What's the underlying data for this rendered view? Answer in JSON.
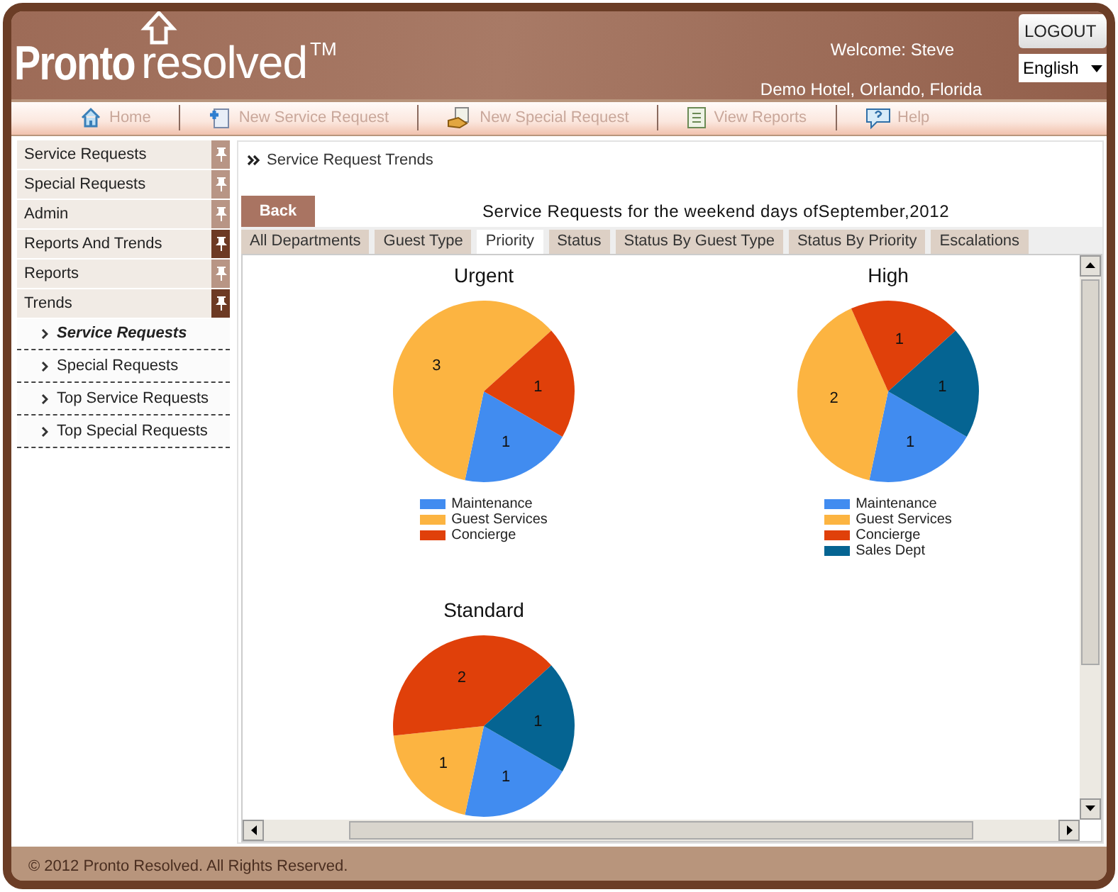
{
  "header": {
    "logo": {
      "bold": "Pronto",
      "light": "resolved",
      "mark": "TM"
    },
    "welcome": "Welcome: Steve",
    "location": "Demo Hotel, Orlando, Florida",
    "logout": "LOGOUT",
    "language": "English"
  },
  "nav": [
    {
      "label": "Home"
    },
    {
      "label": "New Service Request"
    },
    {
      "label": "New Special Request"
    },
    {
      "label": "View Reports"
    },
    {
      "label": "Help"
    }
  ],
  "sidebar": {
    "items": [
      {
        "label": "Service Requests",
        "active": false
      },
      {
        "label": "Special Requests",
        "active": false
      },
      {
        "label": "Admin",
        "active": false
      },
      {
        "label": "Reports And Trends",
        "active": true
      },
      {
        "label": "Reports",
        "active": false
      },
      {
        "label": "Trends",
        "active": true
      }
    ],
    "subitems": [
      {
        "label": "Service Requests",
        "selected": true
      },
      {
        "label": "Special Requests",
        "selected": false
      },
      {
        "label": "Top Service Requests",
        "selected": false
      },
      {
        "label": "Top Special Requests",
        "selected": false
      }
    ]
  },
  "breadcrumb": "Service Request Trends",
  "back": "Back",
  "report_title": "Service Requests for the weekend days ofSeptember,2012",
  "tabs": [
    {
      "label": "All Departments",
      "selected": false
    },
    {
      "label": "Guest Type",
      "selected": false
    },
    {
      "label": "Priority",
      "selected": true
    },
    {
      "label": "Status",
      "selected": false
    },
    {
      "label": "Status By Guest Type",
      "selected": false
    },
    {
      "label": "Status By Priority",
      "selected": false
    },
    {
      "label": "Escalations",
      "selected": false
    }
  ],
  "charts": [
    {
      "slices": [
        {
          "color": "#418cf0"
        },
        {
          "color": "#fcb441"
        },
        {
          "color": "#e0400a"
        }
      ],
      "chart_data": {
        "type": "pie",
        "title": "Urgent",
        "categories": [
          "Maintenance",
          "Guest Services",
          "Concierge"
        ],
        "values": [
          1,
          3,
          1
        ],
        "data_labels": true,
        "value_labels": [
          "1",
          "3",
          "1"
        ],
        "legend": "bottom"
      }
    },
    {
      "slices": [
        {
          "color": "#418cf0"
        },
        {
          "color": "#fcb441"
        },
        {
          "color": "#e0400a"
        },
        {
          "color": "#056492"
        }
      ],
      "chart_data": {
        "type": "pie",
        "title": "High",
        "categories": [
          "Maintenance",
          "Guest Services",
          "Concierge",
          "Sales Dept"
        ],
        "values": [
          1,
          2,
          1,
          1
        ],
        "data_labels": true,
        "value_labels": [
          "1",
          "2",
          "1",
          "1"
        ],
        "legend": "bottom"
      }
    },
    {
      "slices": [
        {
          "color": "#418cf0"
        },
        {
          "color": "#fcb441"
        },
        {
          "color": "#e0400a"
        },
        {
          "color": "#056492"
        }
      ],
      "chart_data": {
        "type": "pie",
        "title": "Standard",
        "values": [
          1,
          1,
          2,
          1
        ],
        "data_labels": true,
        "value_labels": [
          "1",
          "1",
          "2",
          "1"
        ]
      }
    }
  ],
  "footer": "© 2012 Pronto Resolved. All Rights Reserved."
}
